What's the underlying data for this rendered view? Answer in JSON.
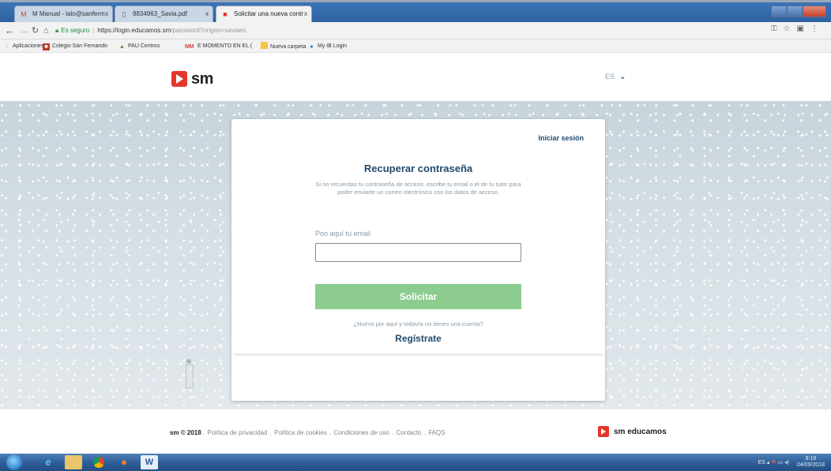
{
  "browser": {
    "tabs": [
      {
        "label": "M Manual - lalo@sanferm",
        "icon": "gmail-icon"
      },
      {
        "label": "9834963_Savia.pdf",
        "icon": "document-icon"
      },
      {
        "label": "Solicitar una nueva contr",
        "icon": "sm-favicon-icon"
      }
    ],
    "tab_close": "x",
    "address": {
      "secure_label": "Es seguro",
      "url_host": "https://login.educamos.sm",
      "url_path": "/password?origen=saviaes"
    },
    "bookmarks": [
      {
        "label": "Aplicaciones",
        "icon": "apps-icon"
      },
      {
        "label": "Colegio San Fernando",
        "icon": "school-icon"
      },
      {
        "label": "PAU Centros",
        "icon": "pau-icon"
      },
      {
        "label": "M",
        "icon": "gmail-icon"
      },
      {
        "label": "E MOMENTO EN EL (",
        "icon": "gmail-icon"
      },
      {
        "label": "Nueva carpeta",
        "icon": "folder-icon"
      },
      {
        "label": "My IB Login",
        "icon": "ib-icon"
      }
    ]
  },
  "header": {
    "logo_text": "sm",
    "language": "ES"
  },
  "card": {
    "login_link": "Iniciar sesión",
    "title": "Recuperar contraseña",
    "description": "Si no recuerdas tu contraseña de acceso, escribe tu email o el de tu tutor para poder enviarte un correo electrónico con los datos de acceso.",
    "email_label": "Pon aquí tu email",
    "email_value": "",
    "submit_label": "Solicitar",
    "new_question": "¿Nuevo por aquí y todavía no tienes una cuenta?",
    "register_label": "Regístrate"
  },
  "footer": {
    "copyright": "sm © 2018",
    "links": [
      "Política de privacidad",
      "Política de cookies",
      "Condiciones de uso",
      "Contacto",
      "FAQS"
    ],
    "brand": "sm educamos"
  },
  "taskbar": {
    "tray_lang": "ES",
    "time": "8:18",
    "date": "04/09/2018"
  },
  "colors": {
    "accent_red": "#e5362b",
    "title_blue": "#1f4a6e",
    "button_green": "#8ccc8f"
  }
}
